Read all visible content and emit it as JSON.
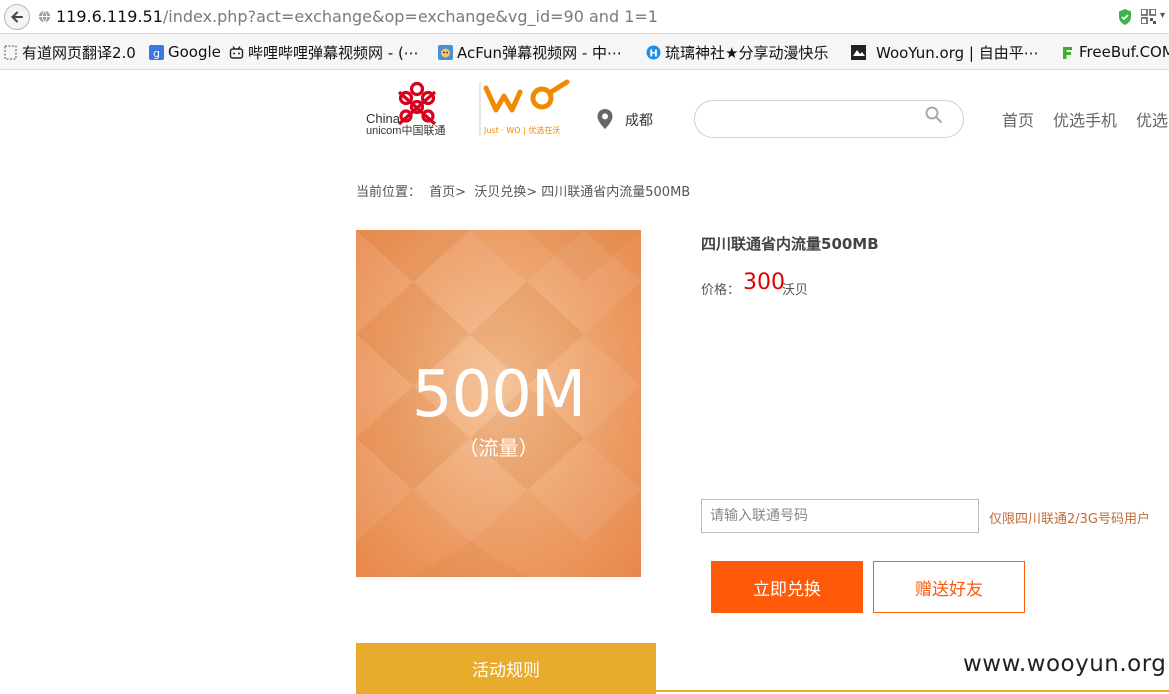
{
  "browser": {
    "url_host": "119.6.119.51",
    "url_path": "/index.php?act=exchange&op=exchange&vg_id=90 and 1=1",
    "bookmarks": [
      {
        "label": "有道网页翻译2.0",
        "icon": "dashed-box-icon"
      },
      {
        "label": "Google",
        "icon": "google-icon"
      },
      {
        "label": "哔哩哔哩弹幕视频网 - (⋯",
        "icon": "bilibili-icon"
      },
      {
        "label": "AcFun弹幕视频网 - 中⋯",
        "icon": "acfun-icon"
      },
      {
        "label": "琉璃神社★分享动漫快乐",
        "icon": "hacg-icon"
      },
      {
        "label": "WooYun.org | 自由平⋯",
        "icon": "wooyun-icon"
      },
      {
        "label": "FreeBuf.COM",
        "icon": "freebuf-icon"
      }
    ]
  },
  "header": {
    "logo_china": "China",
    "logo_unicom": "unicom中国联通",
    "logo_slogan": "Just · WO | 优选在沃",
    "location": "成都",
    "search_placeholder": "",
    "nav": [
      "首页",
      "优选手机",
      "优选"
    ]
  },
  "breadcrumb": {
    "label": "当前位置：",
    "items": [
      "首页>",
      "沃贝兑换>",
      "四川联通省内流量500MB"
    ]
  },
  "product": {
    "image_big": "500M",
    "image_small": "（流量）",
    "title": "四川联通省内流量500MB",
    "price_label": "价格：",
    "price_value": "300",
    "price_unit": "沃贝",
    "phone_placeholder": "请输入联通号码",
    "phone_hint": "仅限四川联通2/3G号码用户",
    "exchange_label": "立即兑换",
    "gift_label": "赠送好友"
  },
  "tabs": {
    "rules_label": "活动规则"
  },
  "watermark": "www.wooyun.org",
  "colors": {
    "accent_orange": "#ff5a0a",
    "tab_gold": "#e9ab2c",
    "price_red": "#e00000",
    "unicom_red": "#d9001b"
  }
}
